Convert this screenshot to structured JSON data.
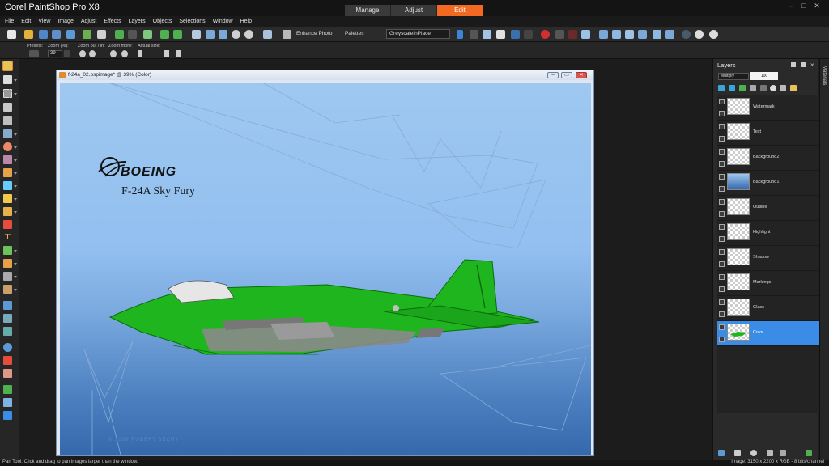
{
  "app": {
    "title": "Corel PaintShop Pro X8",
    "workspace_tabs": [
      {
        "label": "Manage",
        "active": false
      },
      {
        "label": "Adjust",
        "active": false
      },
      {
        "label": "Edit",
        "active": true
      }
    ],
    "accent_color": "#f26a21"
  },
  "menu": [
    "File",
    "Edit",
    "View",
    "Image",
    "Adjust",
    "Effects",
    "Layers",
    "Objects",
    "Selections",
    "Window",
    "Help"
  ],
  "toolbar": {
    "enhance_photo_label": "Enhance Photo",
    "palettes_label": "Palettes",
    "script_select_value": "GreyscaleInPlace"
  },
  "options_bar": {
    "presets_label": "Presets:",
    "zoom_percent_label": "Zoom (%):",
    "zoom_value": "39",
    "zoom_out_in_label": "Zoom out / in:",
    "zoom_more_label": "Zoom more:",
    "actual_size_label": "Actual size:"
  },
  "document": {
    "title": "f-24a_02.pspimage* @  39% (Color)",
    "canvas_text": {
      "boeing": "BOEING",
      "aircraft_name": "F-24A Sky Fury",
      "copyright": "© 2009 ROBERT BECHY"
    }
  },
  "layers_panel": {
    "title": "Layers",
    "blend_mode": "Multiply",
    "opacity": "100",
    "layers": [
      {
        "name": "Watermark",
        "selected": false
      },
      {
        "name": "Text",
        "selected": false
      },
      {
        "name": "Background2",
        "selected": false
      },
      {
        "name": "Background1",
        "selected": false
      },
      {
        "name": "Outline",
        "selected": false
      },
      {
        "name": "Highlight",
        "selected": false
      },
      {
        "name": "Shadow",
        "selected": false
      },
      {
        "name": "Markings",
        "selected": false
      },
      {
        "name": "Glass",
        "selected": false
      },
      {
        "name": "Color",
        "selected": true
      }
    ],
    "selection_color": "#3a8ce6"
  },
  "materials_label": "Materials",
  "status": {
    "left": "Pan Tool: Click and drag to pan images larger than the window.",
    "right": "Image:  3150 x 2200 x RGB - 8 bits/channel"
  }
}
